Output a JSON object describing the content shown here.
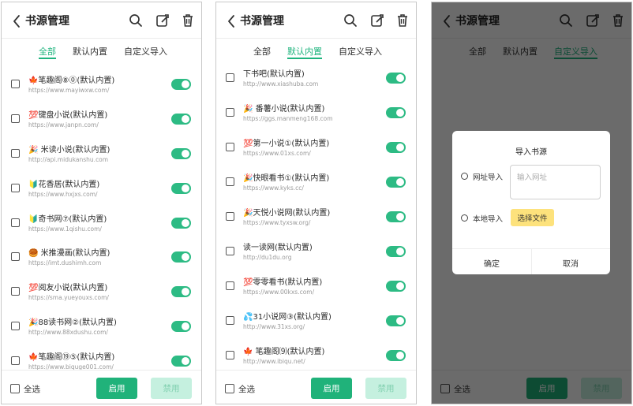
{
  "header": {
    "title": "书源管理"
  },
  "tabs": [
    "全部",
    "默认内置",
    "自定义导入"
  ],
  "screen1": {
    "items": [
      {
        "name": "🍁笔趣阁⑧⓪(默认内置)",
        "url": "https://www.mayiwxw.com/"
      },
      {
        "name": "💯键盘小说(默认内置)",
        "url": "https://www.janpn.com/"
      },
      {
        "name": "🎉 米读小说(默认内置)",
        "url": "http://api.midukanshu.com"
      },
      {
        "name": "🔰花香居(默认内置)",
        "url": "https://www.hxjxs.com/"
      },
      {
        "name": "🔰奇书网⑦(默认内置)",
        "url": "https://www.1qishu.com/"
      },
      {
        "name": "🥮 米推漫画(默认内置)",
        "url": "https://imt.dushimh.com"
      },
      {
        "name": "💯阅友小说(默认内置)",
        "url": "https://sma.yueyouxs.com/"
      },
      {
        "name": "🎉88读书网②(默认内置)",
        "url": "http://www.88xdushu.com/"
      },
      {
        "name": "🍁笔趣阁⑲⑤(默认内置)",
        "url": "https://www.biquge001.com/"
      }
    ]
  },
  "screen2": {
    "items": [
      {
        "name": "下书吧(默认内置)",
        "url": "http://www.xiashuba.com"
      },
      {
        "name": "🎉 番薯小说(默认内置)",
        "url": "https://ggs.manmeng168.com"
      },
      {
        "name": "💯第一小说①(默认内置)",
        "url": "https://www.01xs.com/"
      },
      {
        "name": "🎉快眼看书①(默认内置)",
        "url": "https://www.kyks.cc/"
      },
      {
        "name": "🎉天悦小说网(默认内置)",
        "url": "https://www.tyxsw.org/"
      },
      {
        "name": "读一读网(默认内置)",
        "url": "http://du1du.org"
      },
      {
        "name": "💯零零看书(默认内置)",
        "url": "https://www.00kxs.com/"
      },
      {
        "name": "💦31小说网③(默认内置)",
        "url": "http://www.31xs.org/"
      },
      {
        "name": "🍁 笔趣阁⑼(默认内置)",
        "url": "http://www.ibiqu.net/"
      }
    ]
  },
  "footer": {
    "select_all": "全选",
    "enable": "启用",
    "disable": "禁用"
  },
  "dialog": {
    "title": "导入书源",
    "url_option": "网址导入",
    "url_placeholder": "输入网址",
    "local_option": "本地导入",
    "choose_file": "选择文件",
    "confirm": "确定",
    "cancel": "取消"
  },
  "colors": {
    "accent": "#1fb47e",
    "toggle": "#2dbb84",
    "file_button": "#fde27c"
  }
}
